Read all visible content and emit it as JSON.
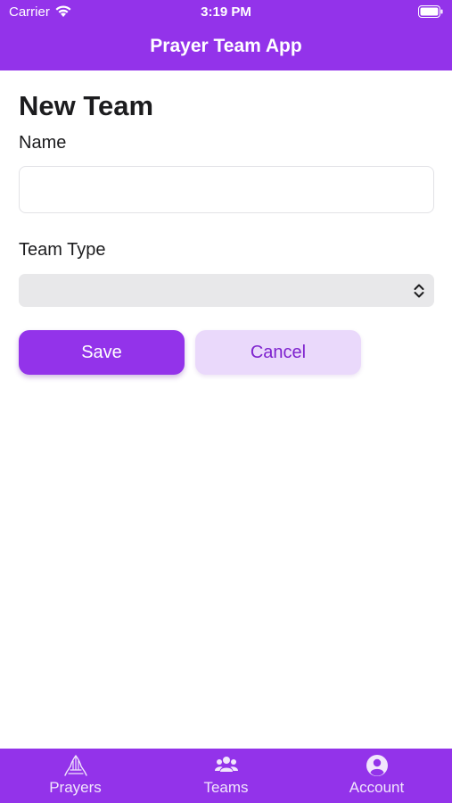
{
  "status_bar": {
    "carrier": "Carrier",
    "time": "3:19 PM"
  },
  "header": {
    "title": "Prayer Team App"
  },
  "form": {
    "heading": "New Team",
    "name_label": "Name",
    "name_value": "",
    "type_label": "Team Type",
    "type_value": ""
  },
  "buttons": {
    "save": "Save",
    "cancel": "Cancel"
  },
  "tabbar": {
    "items": [
      {
        "label": "Prayers",
        "icon": "praying-hands-icon"
      },
      {
        "label": "Teams",
        "icon": "people-group-icon"
      },
      {
        "label": "Account",
        "icon": "user-circle-icon"
      }
    ]
  },
  "colors": {
    "accent": "#9333ea",
    "cancel_bg": "#ead9fb",
    "cancel_text": "#7e22ce",
    "select_bg": "#e8e8ea"
  }
}
